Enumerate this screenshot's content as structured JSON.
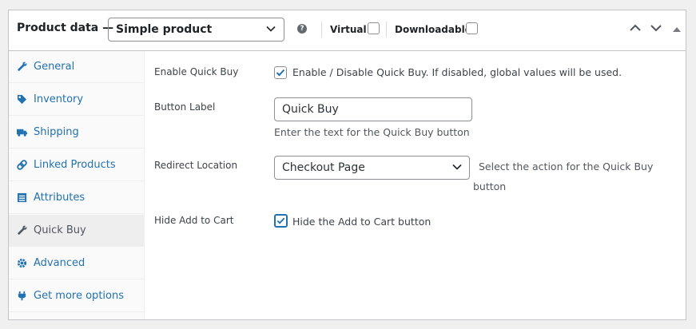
{
  "header": {
    "title": "Product data —",
    "product_type": "Simple product",
    "help_glyph": "?",
    "virtual_label": "Virtual:",
    "downloadable_label": "Downloadable:"
  },
  "tabs": [
    {
      "label": "General",
      "icon": "wrench-icon"
    },
    {
      "label": "Inventory",
      "icon": "tag-icon"
    },
    {
      "label": "Shipping",
      "icon": "truck-icon"
    },
    {
      "label": "Linked Products",
      "icon": "link-icon"
    },
    {
      "label": "Attributes",
      "icon": "list-icon"
    },
    {
      "label": "Quick Buy",
      "icon": "wrench-icon",
      "active": true
    },
    {
      "label": "Advanced",
      "icon": "gear-icon"
    },
    {
      "label": "Get more options",
      "icon": "plugin-icon"
    }
  ],
  "fields": {
    "enable": {
      "label": "Enable Quick Buy",
      "checked": true,
      "text": "Enable / Disable Quick Buy. If disabled, global values will be used."
    },
    "button_label": {
      "label": "Button Label",
      "value": "Quick Buy",
      "desc": "Enter the text for the Quick Buy button"
    },
    "redirect": {
      "label": "Redirect Location",
      "value": "Checkout Page",
      "desc_line1": "Select the action for the Quick Buy",
      "desc_line2": "button"
    },
    "hide_cart": {
      "label": "Hide Add to Cart",
      "checked": true,
      "text": "Hide the Add to Cart button"
    }
  },
  "colors": {
    "link": "#2271b1",
    "border": "#c3c4c7",
    "active_tab": "#eeeeee"
  }
}
